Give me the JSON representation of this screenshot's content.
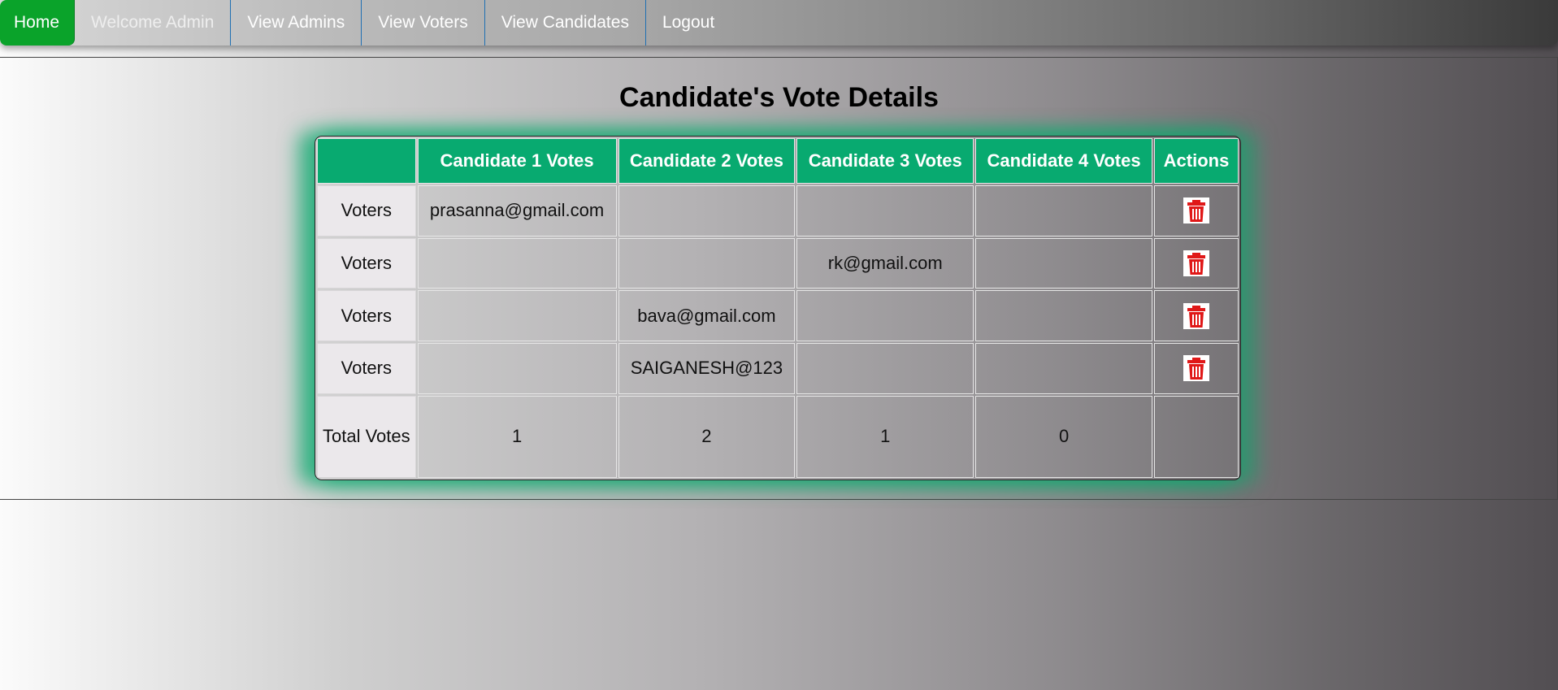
{
  "nav": {
    "items": [
      {
        "label": "Home",
        "active": true
      },
      {
        "label": "Welcome Admin"
      },
      {
        "label": "View Admins"
      },
      {
        "label": "View Voters"
      },
      {
        "label": "View Candidates"
      },
      {
        "label": "Logout"
      }
    ]
  },
  "colors": {
    "nav_active": "#0aa32a",
    "table_header": "#08aa70",
    "delete_icon": "#e01818"
  },
  "page": {
    "title": "Candidate's Vote Details"
  },
  "table": {
    "headers": [
      "",
      "Candidate 1 Votes",
      "Candidate 2 Votes",
      "Candidate 3 Votes",
      "Candidate 4 Votes",
      "Actions"
    ],
    "rows": [
      {
        "label": "Voters",
        "cells": [
          "prasanna@gmail.com",
          "",
          "",
          ""
        ],
        "action_icon": "trash-icon"
      },
      {
        "label": "Voters",
        "cells": [
          "",
          "",
          "rk@gmail.com",
          ""
        ],
        "action_icon": "trash-icon"
      },
      {
        "label": "Voters",
        "cells": [
          "",
          "bava@gmail.com",
          "",
          ""
        ],
        "action_icon": "trash-icon"
      },
      {
        "label": "Voters",
        "cells": [
          "",
          "SAIGANESH@123",
          "",
          ""
        ],
        "action_icon": "trash-icon"
      }
    ],
    "total": {
      "label": "Total Votes",
      "cells": [
        "1",
        "2",
        "1",
        "0"
      ]
    }
  }
}
